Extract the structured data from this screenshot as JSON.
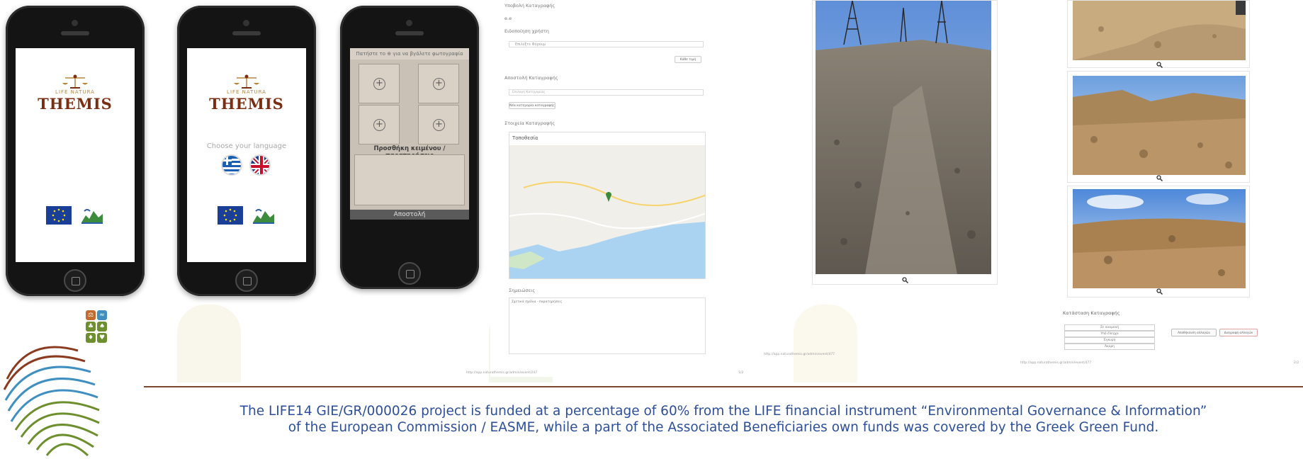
{
  "phone1": {
    "logo_sub": "LIFE NATURA",
    "logo_word": "THEMIS"
  },
  "phone2": {
    "logo_sub": "LIFE NATURA",
    "logo_word": "THEMIS",
    "language_label": "Choose your language"
  },
  "phone3": {
    "header": "Πατήστε το ⊕ για να βγάλετε φωτογραφία",
    "plus_glyph": "+",
    "add_label": "Προσθήκη κειμένου /παρατηρήσεις",
    "send_label": "Αποστολή"
  },
  "form": {
    "user_category_label": "Υποβολή Καταγραφής",
    "user_value": "e.e",
    "usage_label": "Ειδοποίηση χρήστη",
    "usage_select": "Επιλέξτε Φόρουμ",
    "usage_button": "Κάθε τιμή",
    "category_label": "Αποστολή Καταγραφής",
    "category_input": "Επιλογή Κατηγορίας",
    "category_button": "Νέα κατηγορία καταγραφής",
    "location_label": "Στοιχεία Καταγραφής",
    "map_title": "Τοποθεσία",
    "comments_label": "Σημειώσεις",
    "comments_text": "Σχετικά σχόλια - παρατηρήσεις",
    "footer_url": "http://app.naturathemis.gr/admin/event/247",
    "footer_page": "1/2"
  },
  "photos": {
    "left_url": "http://app.naturathemis.gr/admin/event/477",
    "right_url": "http://app.naturathemis.gr/admin/event/477",
    "right_page": "2/2"
  },
  "categories": {
    "title": "Κατάσταση Καταγραφής",
    "rows": [
      "Σε αναμονή",
      "Υπό έλεγχο",
      "Έγκυρη",
      "Άκυρη"
    ],
    "btn_save": "Αποθήκευση αλλαγών",
    "btn_delete": "Διαγραφή αλλαγών"
  },
  "footer": {
    "line1": "The LIFE14 GIE/GR/000026 project is funded at a percentage of 60% from the LIFE financial instrument “Environmental Governance & Information”",
    "line2": "of the European Commission / EASME, while a part of the Associated Beneficiaries own funds was covered by the Greek Green Fund."
  },
  "colors": {
    "footer_text": "#2d4f9a",
    "footer_rule": "#7a4a2a",
    "themis_brown": "#7a2e12",
    "slot_beige": "#d9d0c6"
  }
}
